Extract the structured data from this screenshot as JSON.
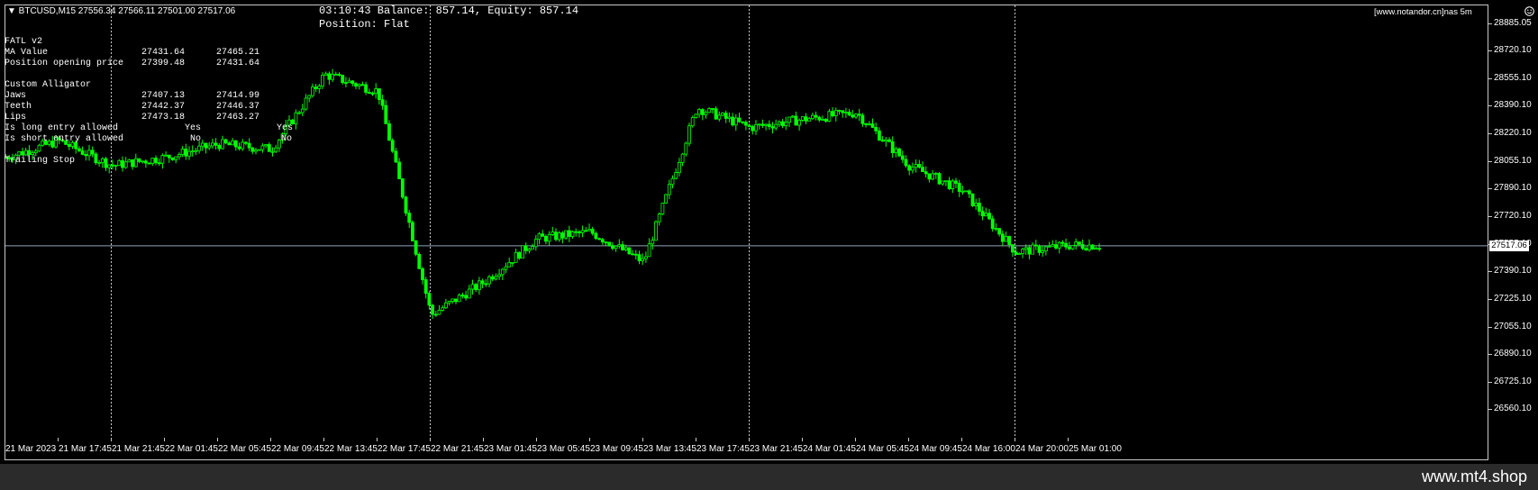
{
  "header": {
    "symbol_line": "▼ BTCUSD,M15  27556.34 27566.11 27501.00 27517.06",
    "status_line1": "03:10:43 Balance: 857.14, Equity: 857.14",
    "status_line2": "Position: Flat",
    "site_label": "[www.notandor.cn]nas 5m"
  },
  "indicator_panel": {
    "fatl_title": "FATL v2",
    "ma_label": "MA Value",
    "ma_v1": "27431.64",
    "ma_v2": "27465.21",
    "pos_label": "Position opening price",
    "pos_v1": "27399.48",
    "pos_v2": "27431.64",
    "alligator_title": "Custom Alligator",
    "jaws_label": "Jaws",
    "jaws_v1": "27407.13",
    "jaws_v2": "27414.99",
    "teeth_label": "Teeth",
    "teeth_v1": "27442.37",
    "teeth_v2": "27446.37",
    "lips_label": "Lips",
    "lips_v1": "27473.18",
    "lips_v2": "27463.27",
    "long_label": "Is long entry allowed",
    "long_v1": "Yes",
    "long_v2": "Yes",
    "short_label": "Is short entry allowed",
    "short_v1": "No",
    "short_v2": "No",
    "trailing_label": "Trailing Stop"
  },
  "current_price_badge": "27517.06",
  "watermark": "www.mt4.shop",
  "colors": {
    "background": "#000000",
    "candle": "#00ff00",
    "grid": "#c8c8c8",
    "price_line": "#8fa3b8",
    "text": "#ffffff"
  },
  "chart_data": {
    "type": "candlestick",
    "symbol": "BTCUSD",
    "timeframe": "M15",
    "ylim": [
      26560.1,
      28885.05
    ],
    "y_ticks": [
      "28885.05",
      "28720.10",
      "28555.10",
      "28390.10",
      "28220.10",
      "28055.10",
      "27890.10",
      "27720.10",
      "27555.10",
      "27390.10",
      "27225.10",
      "27055.10",
      "26890.10",
      "26725.10",
      "26560.10"
    ],
    "x_ticks": [
      "21 Mar 2023",
      "21 Mar 17:45",
      "21 Mar 21:45",
      "22 Mar 01:45",
      "22 Mar 05:45",
      "22 Mar 09:45",
      "22 Mar 13:45",
      "22 Mar 17:45",
      "22 Mar 21:45",
      "23 Mar 01:45",
      "23 Mar 05:45",
      "23 Mar 09:45",
      "23 Mar 13:45",
      "23 Mar 17:45",
      "23 Mar 21:45",
      "24 Mar 01:45",
      "24 Mar 05:45",
      "24 Mar 09:45",
      "24 Mar 16:00",
      "24 Mar 20:00",
      "25 Mar 01:00"
    ],
    "current_price": 27517.06,
    "day_separators": [
      "21 Mar 21:45",
      "22 Mar 21:45",
      "23 Mar 21:45",
      "24 Mar 20:00"
    ],
    "close_path": [
      [
        "21 Mar 2023",
        28050
      ],
      [
        "21 Mar 17:45",
        28150
      ],
      [
        "21 Mar 21:45",
        28000
      ],
      [
        "22 Mar 01:45",
        28050
      ],
      [
        "22 Mar 05:45",
        28130
      ],
      [
        "22 Mar 09:45",
        28100
      ],
      [
        "22 Mar 13:45",
        28550
      ],
      [
        "22 Mar 17:45",
        28450
      ],
      [
        "22 Mar 21:45",
        27100
      ],
      [
        "23 Mar 01:45",
        27300
      ],
      [
        "23 Mar 05:45",
        27560
      ],
      [
        "23 Mar 09:45",
        27600
      ],
      [
        "23 Mar 13:45",
        27420
      ],
      [
        "23 Mar 17:45",
        28350
      ],
      [
        "23 Mar 21:45",
        28230
      ],
      [
        "24 Mar 01:45",
        28280
      ],
      [
        "24 Mar 05:45",
        28320
      ],
      [
        "24 Mar 09:45",
        28000
      ],
      [
        "24 Mar 16:00",
        27850
      ],
      [
        "24 Mar 20:00",
        27480
      ],
      [
        "25 Mar 01:00",
        27520
      ]
    ]
  }
}
